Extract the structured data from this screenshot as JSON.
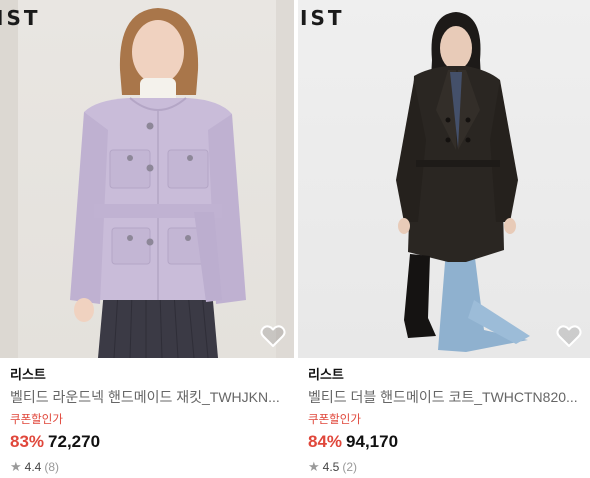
{
  "products": [
    {
      "watermark": "IST",
      "seller": "리스트",
      "title": "벨티드 라운드넥 핸드메이드 재킷_TWHJKN...",
      "coupon_label": "쿠폰할인가",
      "discount": "83%",
      "price": "72,270",
      "rating": "4.4",
      "review_count": "(8)",
      "icons": {
        "favorite": "heart-outline-icon",
        "rating": "star-icon"
      }
    },
    {
      "watermark": "IST",
      "seller": "리스트",
      "title": "벨티드 더블 핸드메이드 코트_TWHCTN820...",
      "coupon_label": "쿠폰할인가",
      "discount": "84%",
      "price": "94,170",
      "rating": "4.5",
      "review_count": "(2)",
      "icons": {
        "favorite": "heart-outline-icon",
        "rating": "star-icon"
      }
    }
  ],
  "colors": {
    "discount": "#e0473b",
    "coupon": "#e0473b",
    "jacket": "#c9bcd9",
    "coat": "#2a2622",
    "star": "#9a9a9a"
  }
}
